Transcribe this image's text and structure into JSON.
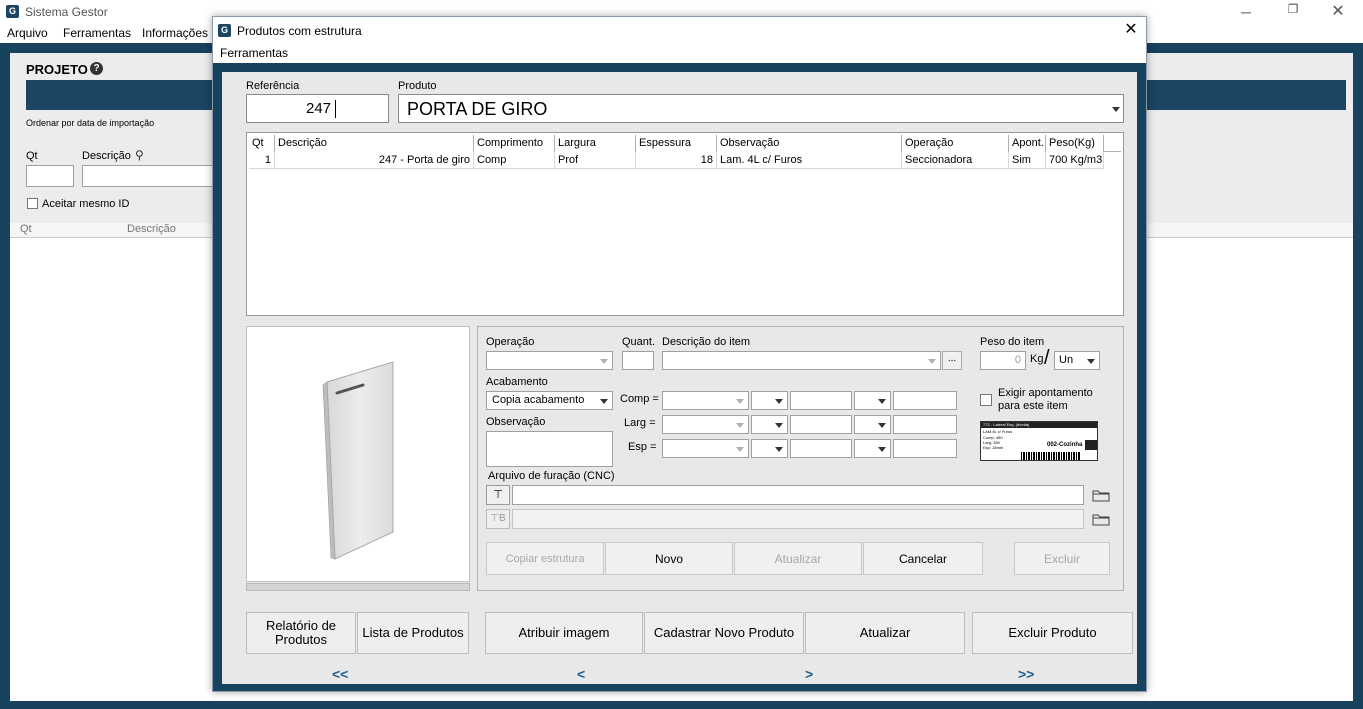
{
  "app": {
    "title": "Sistema Gestor",
    "menu": [
      "Arquivo",
      "Ferramentas",
      "Informações"
    ],
    "projeto_label": "PROJETO",
    "sort_label": "Ordenar por data de importação",
    "qt_label": "Qt",
    "descricao_label": "Descrição",
    "aceitar_label": "Aceitar mesmo ID",
    "list_headers": [
      "Qt",
      "Descrição"
    ]
  },
  "dialog": {
    "title": "Produtos com estrutura",
    "menu": "Ferramentas",
    "referencia_label": "Referência",
    "referencia_value": "247",
    "produto_label": "Produto",
    "produto_value": "PORTA DE GIRO",
    "grid": {
      "headers": [
        "Qt",
        "Descrição",
        "Comprimento",
        "Largura",
        "Espessura",
        "Observação",
        "Operação",
        "Apont.",
        "Peso(Kg)"
      ],
      "rows": [
        [
          "1",
          "247 - Porta de giro",
          "Comp",
          "Prof",
          "18",
          "Lam. 4L c/ Furos",
          "Seccionadora",
          "Sim",
          "700 Kg/m3"
        ]
      ]
    },
    "form": {
      "operacao_label": "Operação",
      "quant_label": "Quant.",
      "descricao_item_label": "Descrição do item",
      "ellipsis": "...",
      "peso_label": "Peso do item",
      "peso_value": "0",
      "kg_label": "Kg",
      "slash": "/",
      "unit_value": "Un",
      "acabamento_label": "Acabamento",
      "acabamento_value": "Copia acabamento",
      "observacao_label": "Observação",
      "comp_label": "Comp =",
      "larg_label": "Larg =",
      "esp_label": "Esp =",
      "exigir_label_1": "Exigir apontamento",
      "exigir_label_2": "para este item",
      "arquivo_label": "Arquivo de furação (CNC)",
      "label_preview": {
        "line1": "772 - Lateral Esq. (direita)",
        "line2": "LAM.4L c/ Furos",
        "line3": "Comp: 450",
        "line4": "Larg: 350",
        "line5": "Esp: 18mm",
        "code": "002-Cozinha"
      }
    },
    "buttons": {
      "copiar": "Copiar estrutura",
      "novo": "Novo",
      "atualizar_item": "Atualizar",
      "cancelar": "Cancelar",
      "excluir": "Excluir"
    },
    "bottom_buttons": {
      "relatorio": "Relatório de Produtos",
      "lista": "Lista de Produtos",
      "atribuir": "Atribuir imagem",
      "cadastrar": "Cadastrar Novo Produto",
      "atualizar": "Atualizar",
      "excluir_produto": "Excluir Produto"
    },
    "nav": {
      "first": "<<",
      "prev": "<",
      "next": ">",
      "last": ">>"
    }
  },
  "colors": {
    "frame": "#17435e",
    "header_bar": "#1b4562",
    "panel": "#e8e8e8",
    "nav_text": "#1f5e8e"
  }
}
